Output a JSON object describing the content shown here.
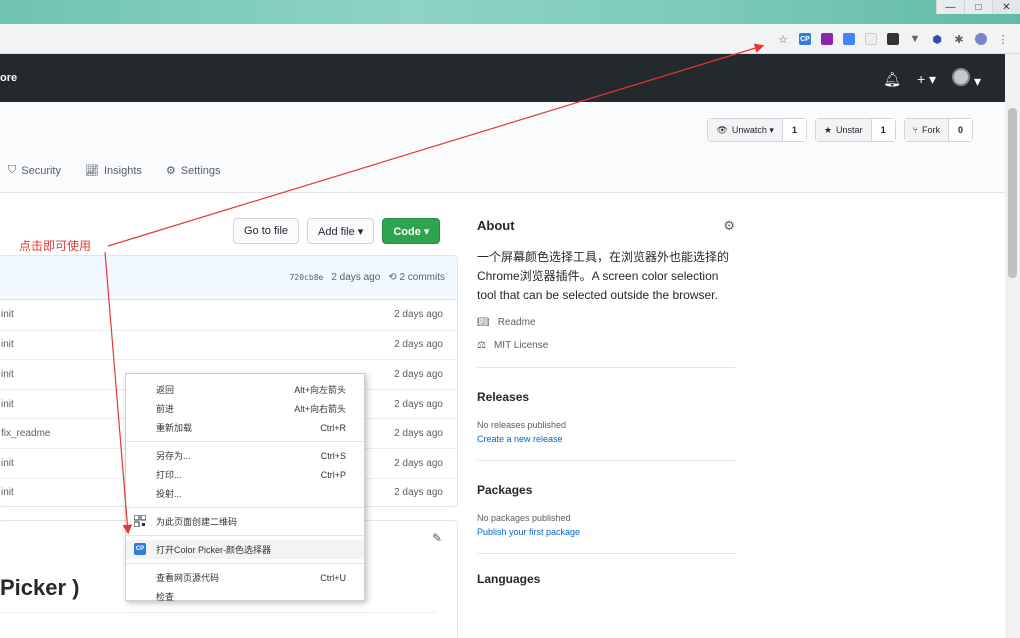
{
  "browser": {
    "window_controls": [
      "—",
      "□",
      "✕"
    ],
    "extensions": [
      "bookmark-star",
      "color-picker",
      "ext-purple",
      "ext-translate",
      "ext-blank",
      "ext-dark",
      "ext-vpn",
      "ext-hex",
      "puzzle",
      "profile",
      "menu"
    ]
  },
  "header": {
    "more_label": "ore",
    "plus_label": "+ ▾"
  },
  "repo": {
    "unwatch": {
      "label": "Unwatch ▾",
      "count": "1"
    },
    "unstar": {
      "label": "Unstar",
      "count": "1"
    },
    "fork": {
      "label": "Fork",
      "count": "0"
    },
    "tabs": [
      {
        "icon": "shield",
        "label": "Security"
      },
      {
        "icon": "graph",
        "label": "Insights"
      },
      {
        "icon": "gear",
        "label": "Settings"
      }
    ]
  },
  "file_buttons": {
    "go_to_file": "Go to file",
    "add_file": "Add file ▾",
    "code": "Code ▾"
  },
  "latest_commit": {
    "hash": "720cb8e",
    "time": "2 days ago",
    "commits": "2 commits"
  },
  "files": [
    {
      "message": "init",
      "time": "2 days ago"
    },
    {
      "message": "init",
      "time": "2 days ago"
    },
    {
      "message": "init",
      "time": "2 days ago"
    },
    {
      "message": "init",
      "time": "2 days ago"
    },
    {
      "message": "fix_readme",
      "time": "2 days ago"
    },
    {
      "message": "init",
      "time": "2 days ago"
    },
    {
      "message": "init",
      "time": "2 days ago"
    }
  ],
  "readme": {
    "title_fragment": "Picker )"
  },
  "sidebar": {
    "about_title": "About",
    "description": "一个屏幕颜色选择工具，在浏览器外也能选择的Chrome浏览器插件。A screen color selection tool that can be selected outside the browser.",
    "readme_link": "Readme",
    "license_link": "MIT License",
    "releases_title": "Releases",
    "releases_sub": "No releases published",
    "releases_link": "Create a new release",
    "packages_title": "Packages",
    "packages_sub": "No packages published",
    "packages_link": "Publish your first package",
    "languages_title": "Languages"
  },
  "context_menu": {
    "group1": [
      {
        "label": "返回",
        "shortcut": "Alt+向左箭头"
      },
      {
        "label": "前进",
        "shortcut": "Alt+向右箭头"
      },
      {
        "label": "重新加载",
        "shortcut": "Ctrl+R"
      }
    ],
    "group2": [
      {
        "label": "另存为...",
        "shortcut": "Ctrl+S"
      },
      {
        "label": "打印...",
        "shortcut": "Ctrl+P"
      },
      {
        "label": "投射...",
        "shortcut": ""
      }
    ],
    "qr_item": "为此页面创建二维码",
    "color_picker_item": "打开Color Picker-颜色选择器",
    "group4": [
      {
        "label": "查看网页源代码",
        "shortcut": "Ctrl+U"
      },
      {
        "label": "检查",
        "shortcut": ""
      }
    ]
  },
  "annotation": {
    "text": "点击即可使用",
    "color": "#e53935"
  },
  "colors": {
    "header": "#24292e",
    "code_button": "#2ea44f",
    "link": "#0366d6",
    "color_picker_icon": "#2f7dd6"
  }
}
